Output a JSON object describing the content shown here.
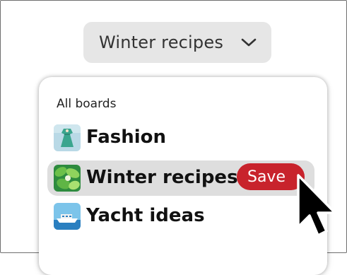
{
  "board_selector": {
    "current": "Winter recipes",
    "icon": "chevron-down-icon"
  },
  "dropdown": {
    "section_title": "All boards",
    "items": [
      {
        "label": "Fashion",
        "icon": "dress-thumbnail",
        "selected": false
      },
      {
        "label": "Winter recipes",
        "icon": "greens-thumbnail",
        "selected": true
      },
      {
        "label": "Yacht ideas",
        "icon": "yacht-thumbnail",
        "selected": false
      }
    ],
    "save_label": "Save"
  },
  "colors": {
    "save_button": "#c8232c",
    "selected_row": "#dedede",
    "selector_bg": "#e6e6e6"
  }
}
